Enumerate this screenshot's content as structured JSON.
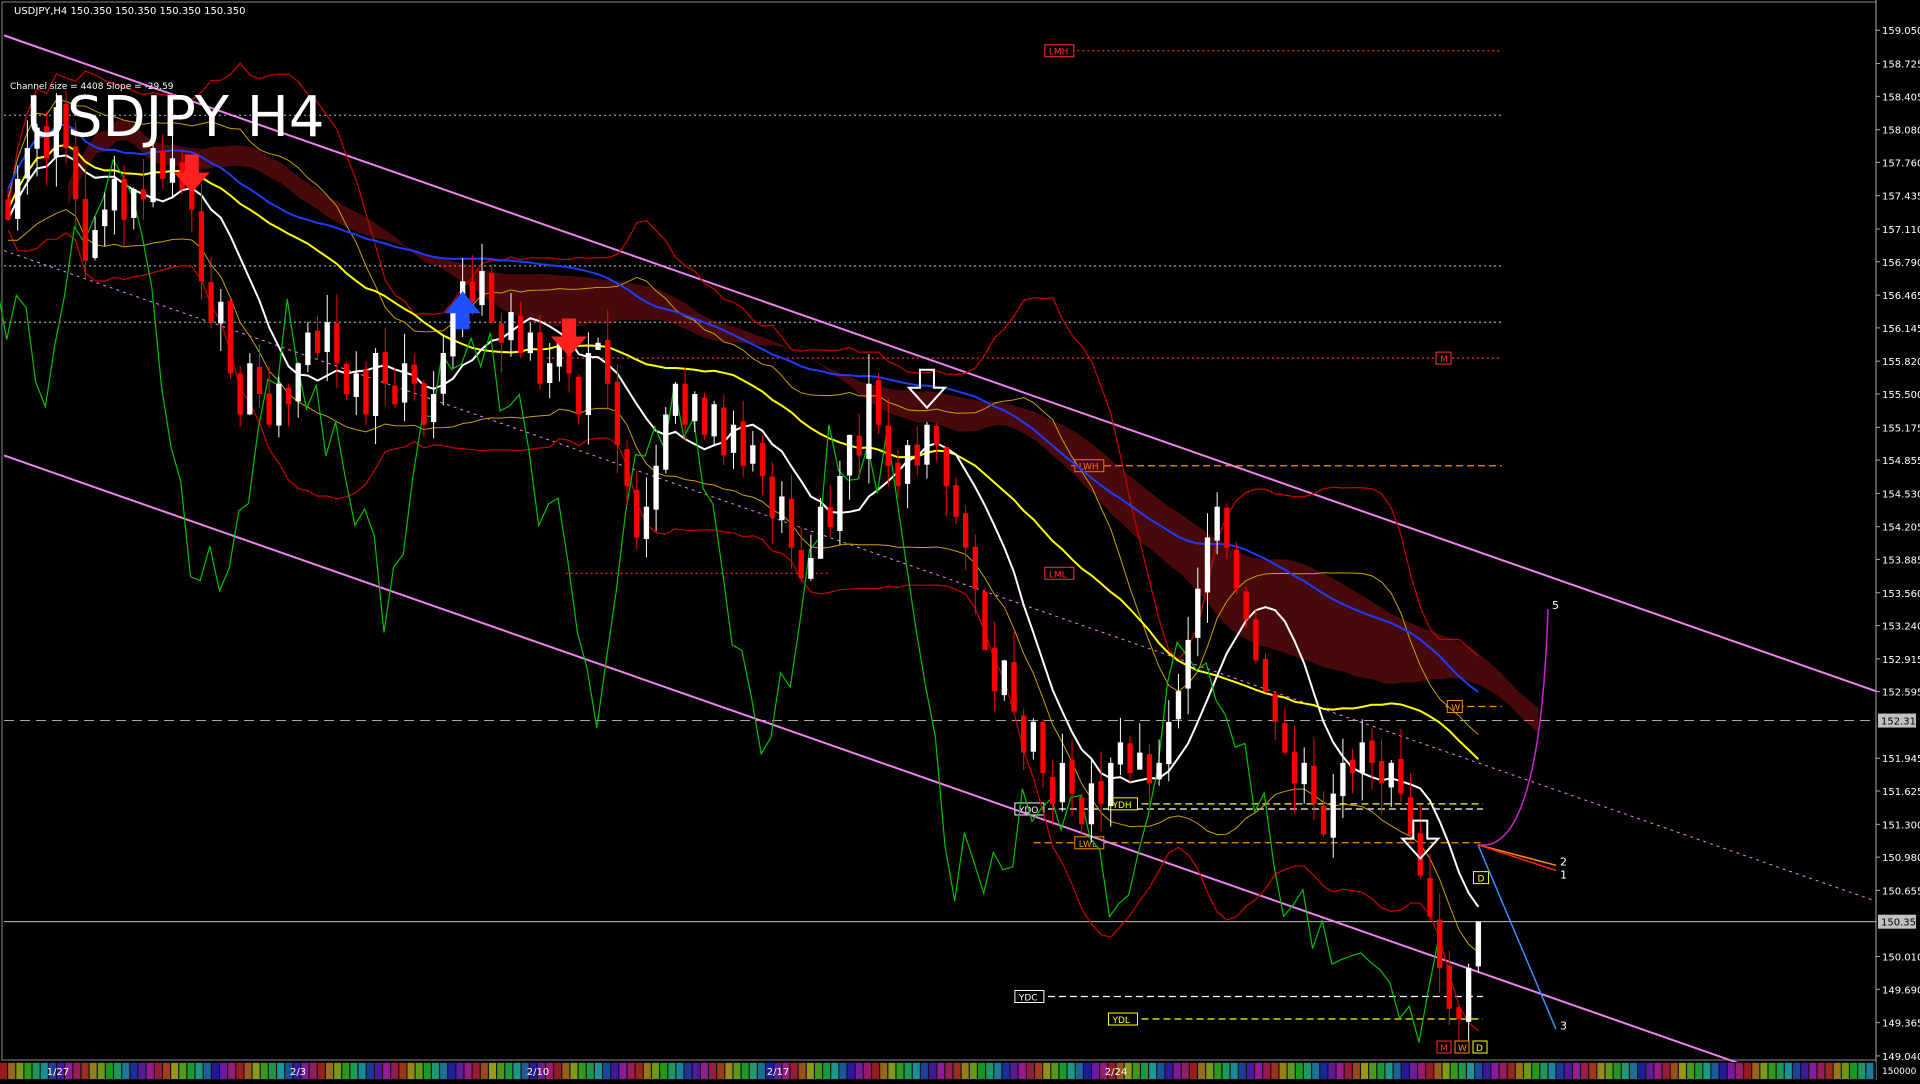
{
  "header": {
    "symbol_info": "USDJPY,H4",
    "ohlc": "150.350 150.350 150.350 150.350",
    "channel_info": "Channel size = 4408 Slope = -29.59",
    "big_title": "USDJPY H4"
  },
  "colors": {
    "background": "#000000",
    "bull_candle": "#ffffff",
    "bear_candle": "#ff0000",
    "channel": "#ee82ee",
    "ma_fast": "#ffffff",
    "ma_mid": "#ffff00",
    "ma_slow": "#1e3cff",
    "oscillator": "#00c000",
    "bollinger": "#cc0000",
    "envelope": "#c8a000",
    "cloud_bear": "#ff2020",
    "cloud_bull": "#3050ff",
    "level_line": "#9ab",
    "price_line": "#c0c0c0"
  },
  "chart_data": {
    "type": "candlestick",
    "symbol": "USDJPY",
    "timeframe": "H4",
    "ylim": [
      149.0,
      159.15
    ],
    "y_ticks": [
      "159.050",
      "158.725",
      "158.405",
      "158.080",
      "157.760",
      "157.435",
      "157.110",
      "156.790",
      "156.465",
      "156.145",
      "155.820",
      "155.500",
      "155.175",
      "154.855",
      "154.530",
      "154.205",
      "153.885",
      "153.560",
      "153.240",
      "152.915",
      "152.595",
      "151.945",
      "151.625",
      "151.300",
      "150.980",
      "150.655",
      "150.010",
      "149.690",
      "149.365",
      "149.040"
    ],
    "x_ticks": [
      "1/27",
      "2/3",
      "2/10",
      "2/17",
      "2/24"
    ],
    "current_price": 150.35,
    "current_price_label": "150.350",
    "dashed_price_label": "152.313",
    "dashed_price": 152.313,
    "bottom_axis_label": "150000",
    "close_series": [
      157.2,
      157.6,
      157.9,
      158.1,
      157.8,
      158.3,
      157.9,
      157.4,
      156.8,
      157.1,
      157.3,
      157.6,
      157.2,
      157.5,
      157.4,
      157.9,
      157.6,
      157.8,
      157.5,
      157.3,
      156.6,
      156.2,
      156.4,
      155.7,
      155.3,
      155.8,
      155.5,
      155.2,
      155.6,
      155.4,
      155.8,
      156.1,
      155.9,
      156.2,
      155.8,
      155.5,
      155.7,
      155.3,
      155.9,
      155.6,
      155.4,
      155.8,
      155.6,
      155.2,
      155.5,
      155.9,
      156.3,
      156.6,
      156.4,
      156.7,
      156.2,
      156.0,
      156.3,
      155.9,
      156.1,
      155.6,
      155.8,
      156.0,
      155.7,
      155.3,
      155.9,
      156.0,
      155.6,
      155.0,
      154.6,
      154.1,
      154.4,
      154.8,
      155.3,
      155.6,
      155.2,
      155.5,
      155.1,
      155.4,
      154.9,
      155.2,
      154.8,
      155.0,
      154.7,
      154.3,
      154.5,
      154.0,
      153.7,
      153.9,
      154.4,
      154.2,
      154.7,
      155.1,
      154.9,
      155.6,
      155.2,
      154.8,
      154.6,
      155.0,
      154.8,
      155.2,
      155.0,
      154.6,
      154.3,
      154.0,
      153.6,
      153.0,
      152.6,
      152.9,
      152.4,
      152.0,
      152.3,
      151.8,
      151.5,
      151.9,
      151.6,
      151.3,
      151.7,
      151.5,
      151.9,
      152.1,
      151.8,
      152.0,
      151.7,
      151.9,
      152.3,
      152.6,
      153.1,
      153.6,
      154.1,
      154.4,
      154.0,
      153.6,
      153.3,
      152.9,
      152.6,
      152.3,
      152.0,
      151.7,
      151.9,
      151.5,
      151.2,
      151.6,
      151.9,
      151.8,
      152.1,
      151.9,
      151.7,
      151.9,
      151.6,
      151.2,
      150.8,
      150.4,
      149.9,
      149.5,
      149.4,
      149.9,
      150.35
    ],
    "channel": {
      "upper_start": 159.0,
      "upper_end": 152.6,
      "lower_start": 154.9,
      "lower_end": 148.5,
      "mid_start": 156.9,
      "mid_end": 150.55
    },
    "levels": [
      {
        "label": "LMH",
        "price": 158.85,
        "color": "#ff3030",
        "style": "dotted",
        "from": 0.56,
        "to": 0.8,
        "label_at": 0.556
      },
      {
        "label": "",
        "price": 158.22,
        "color": "#8aa",
        "style": "dotted",
        "from": 0.0,
        "to": 0.8
      },
      {
        "label": "",
        "price": 156.75,
        "color": "#8aa",
        "style": "dotted",
        "from": 0.0,
        "to": 0.8
      },
      {
        "label": "",
        "price": 156.2,
        "color": "#8aa",
        "style": "dotted",
        "from": 0.0,
        "to": 0.8
      },
      {
        "label": "M",
        "price": 155.85,
        "color": "#ff3030",
        "style": "dotted",
        "from": 0.29,
        "to": 0.8,
        "label_at": 0.765
      },
      {
        "label": "LWH",
        "price": 154.8,
        "color": "#ff8c00",
        "style": "dashed",
        "from": 0.57,
        "to": 0.8,
        "label_at": 0.572
      },
      {
        "label": "LML",
        "price": 153.75,
        "color": "#ff3030",
        "style": "dotted",
        "from": 0.3,
        "to": 0.44,
        "label_at": 0.556
      },
      {
        "label": "W",
        "price": 152.45,
        "color": "#ff8c00",
        "style": "dashed",
        "from": 0.77,
        "to": 0.8,
        "label_at": 0.771
      },
      {
        "label": "YDO",
        "price": 151.45,
        "color": "#ffffff",
        "style": "dashed",
        "from": 0.54,
        "to": 0.79,
        "label_at": 0.54
      },
      {
        "label": "YDH",
        "price": 151.5,
        "color": "#ffff00",
        "style": "dashed",
        "from": 0.59,
        "to": 0.79,
        "label_at": 0.59
      },
      {
        "label": "LWL",
        "price": 151.12,
        "color": "#ff8c00",
        "style": "dashed",
        "from": 0.55,
        "to": 0.79,
        "label_at": 0.572
      },
      {
        "label": "YDC",
        "price": 149.62,
        "color": "#ffffff",
        "style": "dashed",
        "from": 0.54,
        "to": 0.79,
        "label_at": 0.54
      },
      {
        "label": "YDL",
        "price": 149.4,
        "color": "#ffff00",
        "style": "dashed",
        "from": 0.59,
        "to": 0.79,
        "label_at": 0.59
      },
      {
        "label": "D",
        "price": 150.78,
        "color": "#ffff00",
        "style": "none",
        "from": 0.785,
        "to": 0.785,
        "label_at": 0.785
      }
    ],
    "bottom_tags": [
      "M",
      "W",
      "D"
    ],
    "projection_labels": [
      "5",
      "2",
      "1",
      "3"
    ],
    "arrows": [
      {
        "type": "down-red",
        "index": 19
      },
      {
        "type": "up-blue",
        "index": 47
      },
      {
        "type": "down-red",
        "index": 58
      },
      {
        "type": "down-white",
        "index": 95
      },
      {
        "type": "down-white",
        "index": 146
      }
    ]
  }
}
